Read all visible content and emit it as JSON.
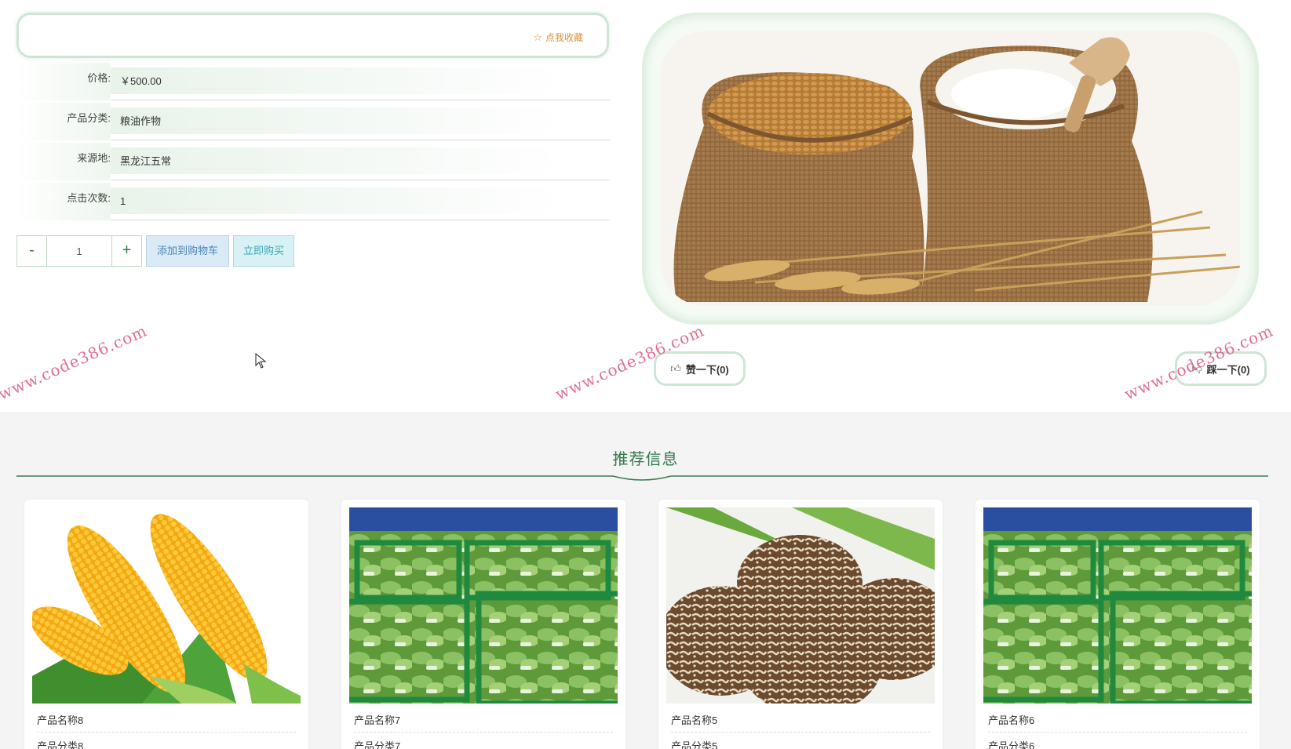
{
  "detail": {
    "favorite_label": "点我收藏",
    "favorite_icon": "star-outline-icon",
    "fields": [
      {
        "label": "价格:",
        "value": "￥500.00"
      },
      {
        "label": "产品分类:",
        "value": "粮油作物"
      },
      {
        "label": "来源地:",
        "value": "黑龙江五常"
      },
      {
        "label": "点击次数:",
        "value": "1"
      }
    ],
    "quantity": {
      "minus": "-",
      "value": "1",
      "plus": "+"
    },
    "add_to_cart_label": "添加到购物车",
    "buy_now_label": "立即购买",
    "like_label": "赞一下(0)",
    "dislike_label": "踩一下(0)"
  },
  "watermark_text": "www.code386.com",
  "recommend": {
    "title": "推荐信息",
    "items": [
      {
        "name": "产品名称8",
        "category": "产品分类8",
        "image": "corn"
      },
      {
        "name": "产品名称7",
        "category": "产品分类7",
        "image": "bok-choy"
      },
      {
        "name": "产品名称5",
        "category": "产品分类5",
        "image": "shiitake"
      },
      {
        "name": "产品名称6",
        "category": "产品分类6",
        "image": "bok-choy"
      }
    ]
  },
  "colors": {
    "accent_green": "#2f7b4a",
    "frame_green": "#cfe5d3",
    "favorite_orange": "#d9903a",
    "cart_blue": "#4a86b7",
    "buy_cyan": "#3ba8b6",
    "watermark_pink": "#d63c6e"
  }
}
